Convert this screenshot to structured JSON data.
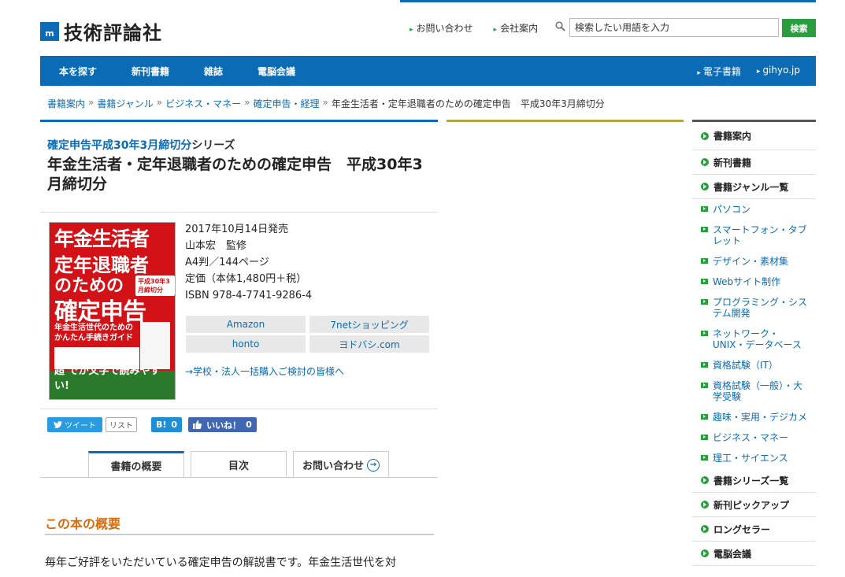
{
  "header": {
    "logo_mark": "m",
    "logo_text": "技術評論社",
    "links": [
      "お問い合わせ",
      "会社案内"
    ],
    "search_placeholder": "検索したい用語を入力",
    "search_button": "検索"
  },
  "nav": {
    "items": [
      "本を探す",
      "新刊書籍",
      "雑誌",
      "電脳会議"
    ],
    "right": [
      "電子書籍",
      "gihyo.jp"
    ]
  },
  "breadcrumb": {
    "links": [
      "書籍案内",
      "書籍ジャンル",
      "ビジネス・マネー",
      "確定申告・経理"
    ],
    "sep": "»",
    "current": "年金生活者・定年退職者のための確定申告　平成30年3月締切分"
  },
  "book": {
    "series_link": "確定申告平成30年3月締切分",
    "series_suffix": "シリーズ",
    "title": "年金生活者・定年退職者のための確定申告　平成30年3月締切分",
    "release": "2017年10月14日発売",
    "author": "山本宏　監修",
    "format": "A4判／144ページ",
    "price": "定価（本体1,480円＋税）",
    "isbn": "ISBN 978-4-7741-9286-4",
    "cover": {
      "line1": "年金生活者",
      "line2": "定年退職者",
      "line3": "のための",
      "line4": "確定申告",
      "badge": "平成30年3月締切分",
      "sub1": "年金生活世代のための",
      "sub2": "かんたん手続きガイド",
      "bottom": "超 でか文字で読みやすい!"
    }
  },
  "buy": [
    "Amazon",
    "7netショッピング",
    "honto",
    "ヨドバシ.com"
  ],
  "bulk_link": "→学校・法人一括購入ご検討の皆様へ",
  "social": {
    "tweet": "ツイート",
    "list": "リスト",
    "hatena": "B!",
    "hatena_count": "0",
    "fb": "いいね！",
    "fb_count": "0"
  },
  "tabs": [
    "書籍の概要",
    "目次",
    "お問い合わせ"
  ],
  "overview": {
    "heading": "この本の概要",
    "text": "毎年ご好評をいただいている確定申告の解説書です。年金生活世代を対"
  },
  "sidebar": [
    {
      "type": "head",
      "label": "書籍案内"
    },
    {
      "type": "head",
      "label": "新刊書籍"
    },
    {
      "type": "head",
      "label": "書籍ジャンル一覧"
    },
    {
      "type": "sub",
      "label": "パソコン"
    },
    {
      "type": "sub",
      "label": "スマートフォン・タブレット"
    },
    {
      "type": "sub",
      "label": "デザイン・素材集"
    },
    {
      "type": "sub",
      "label": "Webサイト制作"
    },
    {
      "type": "sub",
      "label": "プログラミング・システム開発"
    },
    {
      "type": "sub",
      "label": "ネットワーク・UNIX・データベース"
    },
    {
      "type": "sub",
      "label": "資格試験（IT）"
    },
    {
      "type": "sub",
      "label": "資格試験（一般）・大学受験"
    },
    {
      "type": "sub",
      "label": "趣味・実用・デジカメ"
    },
    {
      "type": "sub",
      "label": "ビジネス・マネー"
    },
    {
      "type": "sub",
      "label": "理工・サイエンス"
    },
    {
      "type": "head",
      "label": "書籍シリーズ一覧"
    },
    {
      "type": "head",
      "label": "新刊ピックアップ"
    },
    {
      "type": "head",
      "label": "ロングセラー"
    },
    {
      "type": "head",
      "label": "電脳会議"
    }
  ]
}
